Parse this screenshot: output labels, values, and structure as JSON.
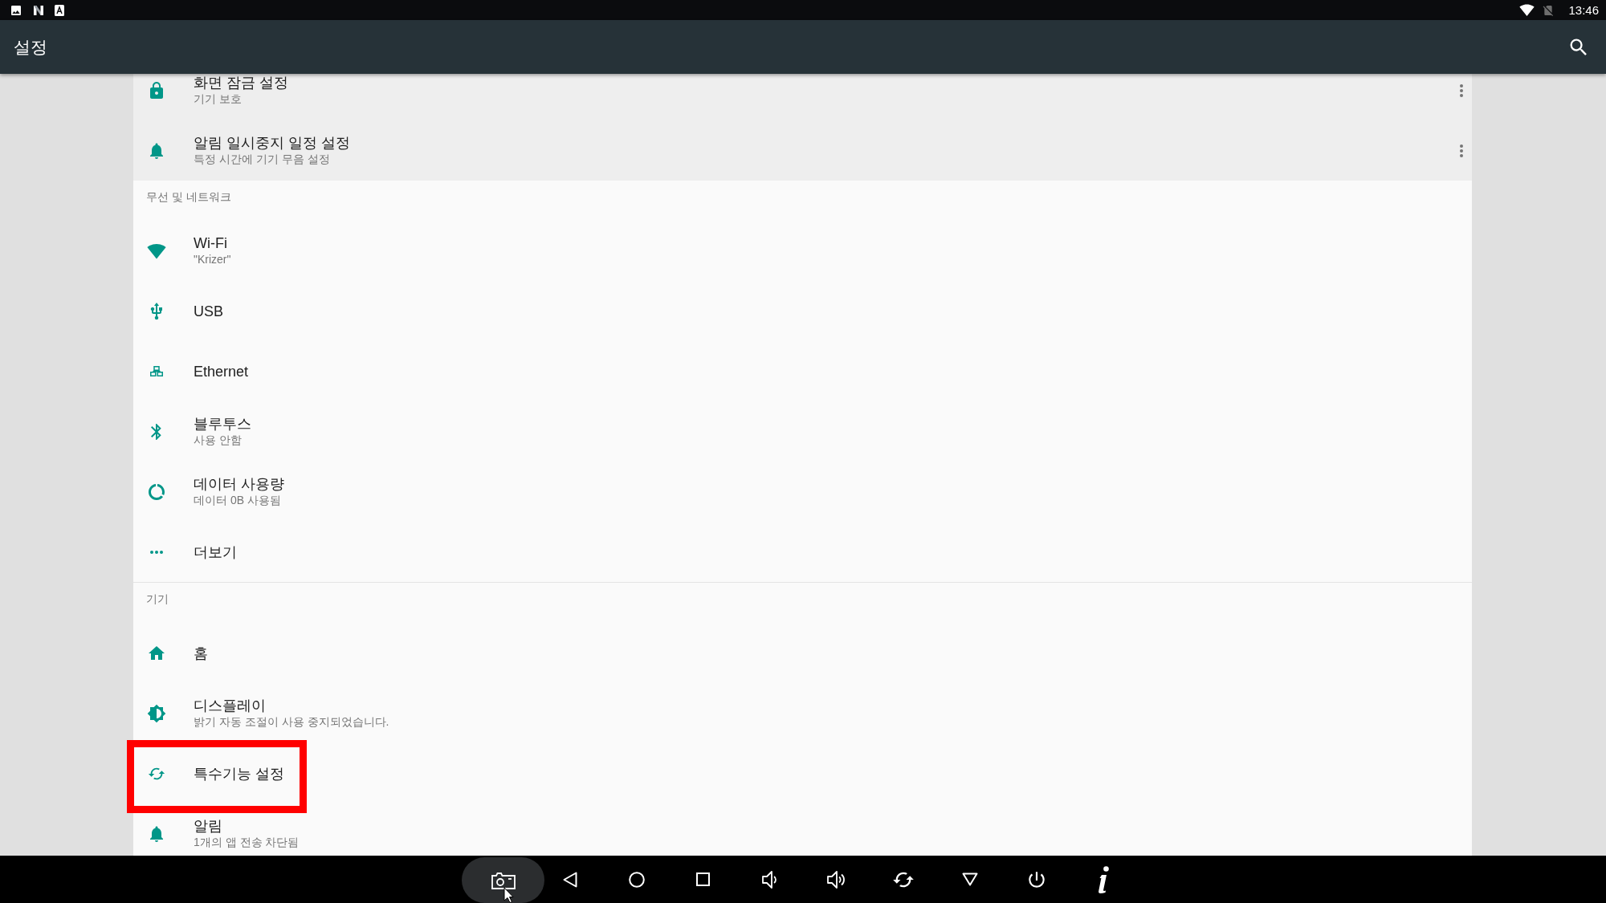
{
  "status_bar": {
    "time": "13:46"
  },
  "app_bar": {
    "title": "설정"
  },
  "suggestions": [
    {
      "title": "화면 잠금 설정",
      "subtitle": "기기 보호"
    },
    {
      "title": "알림 일시중지 일정 설정",
      "subtitle": "특정 시간에 기기 무음 설정"
    }
  ],
  "categories": [
    {
      "title": "무선 및 네트워크",
      "items": [
        {
          "title": "Wi-Fi",
          "subtitle": "\"Krizer\"",
          "highlighted": false
        },
        {
          "title": "USB",
          "highlighted": false
        },
        {
          "title": "Ethernet",
          "highlighted": false
        },
        {
          "title": "블루투스",
          "subtitle": "사용 안함",
          "highlighted": false
        },
        {
          "title": "데이터 사용량",
          "subtitle": "데이터 0B 사용됨",
          "highlighted": false
        },
        {
          "title": "더보기",
          "highlighted": false
        }
      ]
    },
    {
      "title": "기기",
      "items": [
        {
          "title": "홈",
          "highlighted": false
        },
        {
          "title": "디스플레이",
          "subtitle": "밝기 자동 조절이 사용 중지되었습니다.",
          "highlighted": false
        },
        {
          "title": "특수기능 설정",
          "highlighted": true
        },
        {
          "title": "알림",
          "subtitle": "1개의 앱 전송 차단됨",
          "highlighted": false
        }
      ]
    }
  ],
  "nav_bar": {
    "buttons": [
      {
        "kind": "screenshot",
        "hovered": true
      },
      {
        "kind": "back",
        "hovered": false
      },
      {
        "kind": "home",
        "hovered": false
      },
      {
        "kind": "recents",
        "hovered": false
      },
      {
        "kind": "voldown",
        "hovered": false
      },
      {
        "kind": "volup",
        "hovered": false
      },
      {
        "kind": "rotate",
        "hovered": false
      },
      {
        "kind": "down",
        "hovered": false
      },
      {
        "kind": "power",
        "hovered": false
      },
      {
        "kind": "info",
        "hovered": false
      }
    ]
  }
}
